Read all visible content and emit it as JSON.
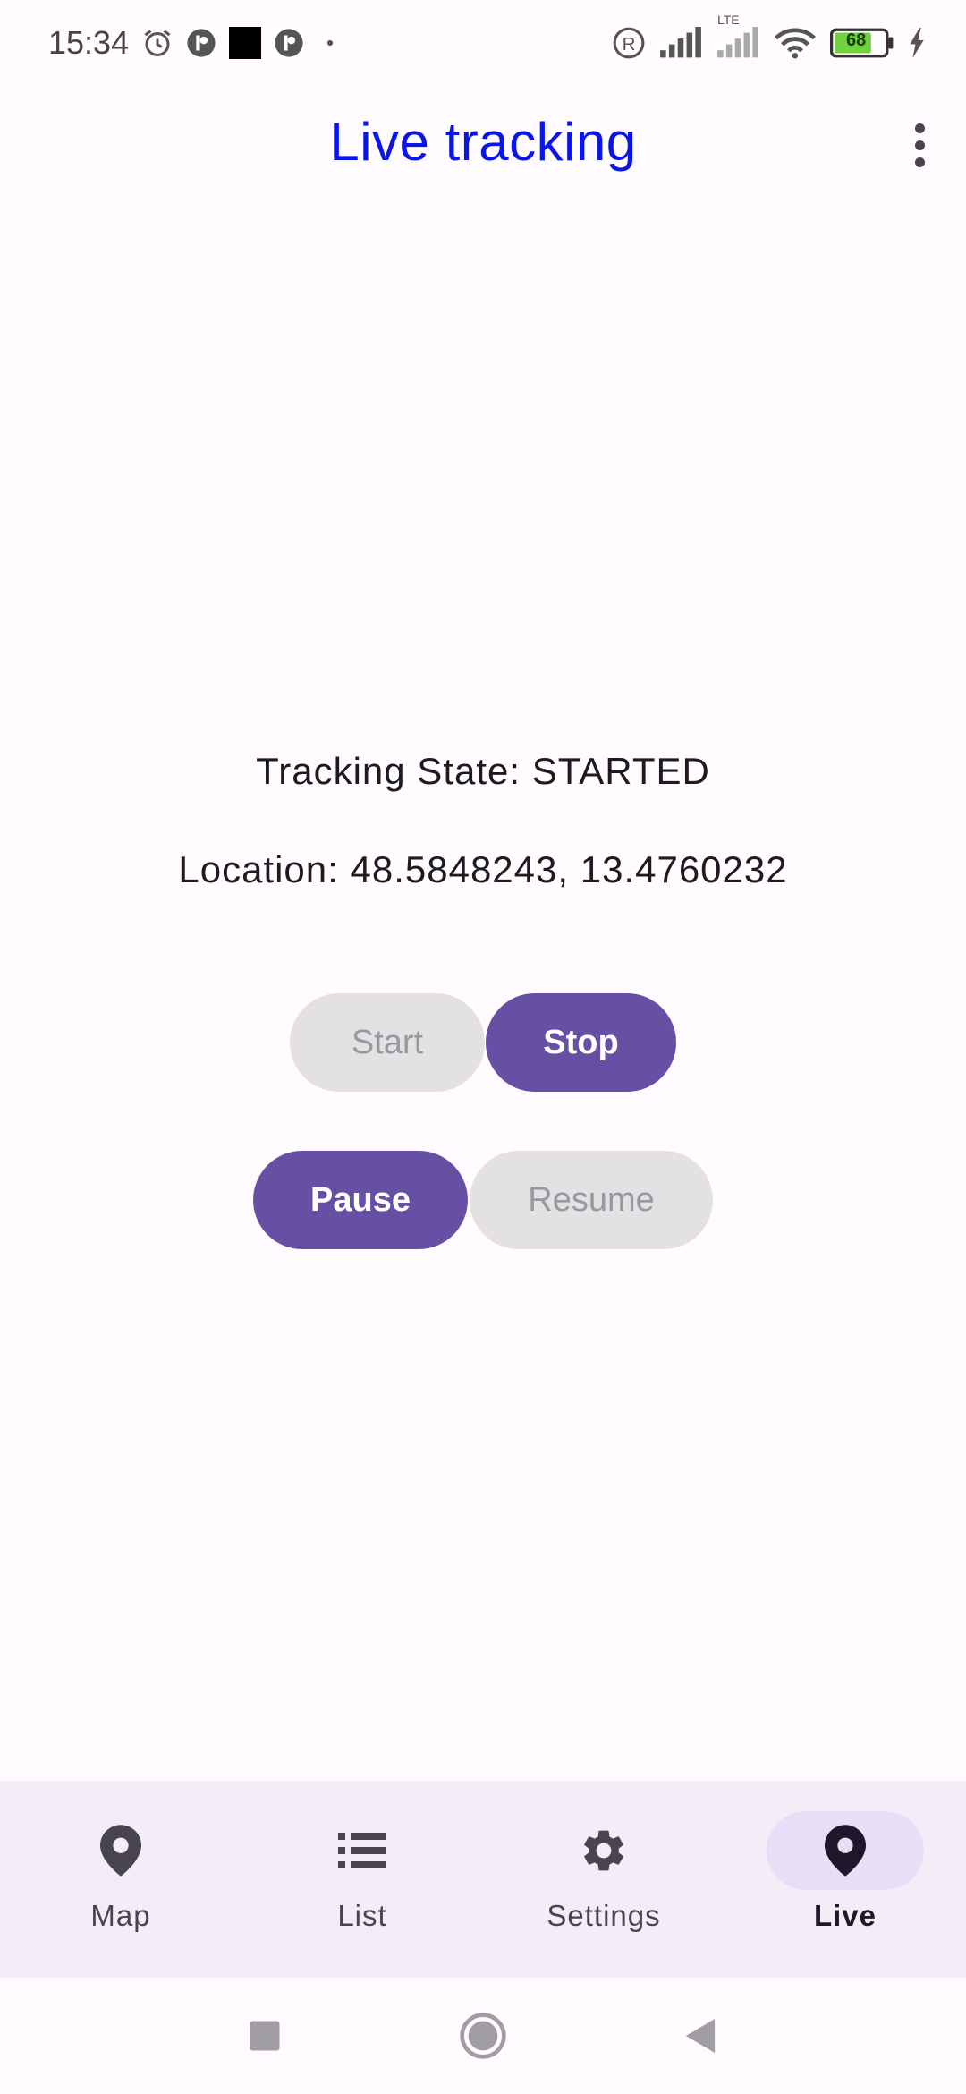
{
  "status_bar": {
    "time": "15:34",
    "network": "LTE",
    "battery": "68",
    "icons": [
      "alarm-icon",
      "app-notification-icon",
      "black-square-icon",
      "app-notification-icon",
      "dot-icon",
      "registered-icon",
      "signal-icon",
      "lte-signal-icon",
      "wifi-icon",
      "battery-icon",
      "charging-icon"
    ]
  },
  "app_bar": {
    "title": "Live tracking",
    "title_color": "#0b16e6",
    "menu_icon": "more-vert-icon"
  },
  "main": {
    "tracking_state": "Tracking State: STARTED",
    "location": "Location: 48.5848243, 13.4760232",
    "buttons": {
      "start": {
        "label": "Start",
        "enabled": false
      },
      "stop": {
        "label": "Stop",
        "enabled": true
      },
      "pause": {
        "label": "Pause",
        "enabled": true
      },
      "resume": {
        "label": "Resume",
        "enabled": false
      }
    },
    "accent_color": "#6750a4"
  },
  "bottom_nav": {
    "items": [
      {
        "label": "Map",
        "icon": "location-pin-icon",
        "active": false
      },
      {
        "label": "List",
        "icon": "list-icon",
        "active": false
      },
      {
        "label": "Settings",
        "icon": "gear-icon",
        "active": false
      },
      {
        "label": "Live",
        "icon": "location-pin-icon",
        "active": true
      }
    ]
  },
  "system_nav": {
    "buttons": [
      "recents-icon",
      "home-icon",
      "back-icon"
    ]
  }
}
